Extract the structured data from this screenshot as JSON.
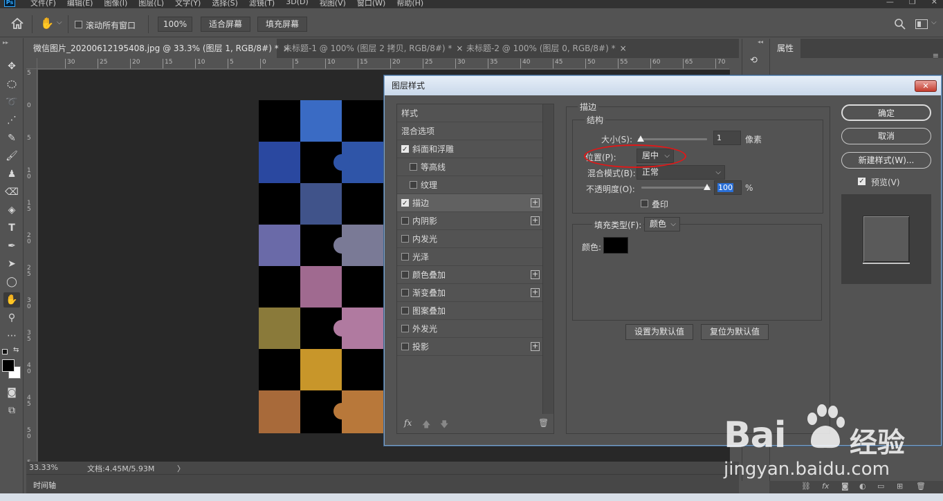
{
  "menubar": {
    "logo": "Ps",
    "items": [
      "文件(F)",
      "编辑(E)",
      "图像(I)",
      "图层(L)",
      "文字(Y)",
      "选择(S)",
      "滤镜(T)",
      "3D(D)",
      "视图(V)",
      "窗口(W)",
      "帮助(H)"
    ],
    "window_controls": [
      "—",
      "❐",
      "✕"
    ]
  },
  "options": {
    "scroll_all_label": "滚动所有窗口",
    "zoom_value": "100%",
    "fit_screen": "适合屏幕",
    "fill_screen": "填充屏幕"
  },
  "tabs": [
    {
      "label": "微信图片_20200612195408.jpg @ 33.3% (图层 1, RGB/8#) *",
      "close": "×"
    },
    {
      "label": "未标题-1 @ 100% (图层 2 拷贝, RGB/8#) *",
      "close": "×"
    },
    {
      "label": "未标题-2 @ 100% (图层 0, RGB/8#) *",
      "close": "×"
    }
  ],
  "ruler": {
    "h_labels": [
      "30",
      "25",
      "20",
      "15",
      "10",
      "5",
      "0",
      "5",
      "10",
      "15",
      "20",
      "25",
      "30",
      "35",
      "40",
      "45",
      "50",
      "55",
      "60",
      "65",
      "70"
    ],
    "v_labels": [
      "5",
      "0",
      "5",
      "1 0",
      "1 5",
      "2 0",
      "2 5",
      "3 0",
      "3 5",
      "4 0",
      "4 5",
      "5 0",
      "5 5"
    ]
  },
  "status": {
    "zoom": "33.33%",
    "doc": "文档:4.45M/5.93M",
    "arrow": "〉",
    "timeline": "时间轴"
  },
  "props": {
    "title": "属性"
  },
  "dialog": {
    "title": "图层样式",
    "close": "✕",
    "styles": [
      {
        "label": "样式",
        "checkbox": false,
        "checked": false,
        "plus": false,
        "indent": 0,
        "selected": false
      },
      {
        "label": "混合选项",
        "checkbox": false,
        "checked": false,
        "plus": false,
        "indent": 0,
        "selected": false
      },
      {
        "label": "斜面和浮雕",
        "checkbox": true,
        "checked": true,
        "plus": false,
        "indent": 0,
        "selected": false
      },
      {
        "label": "等高线",
        "checkbox": true,
        "checked": false,
        "plus": false,
        "indent": 1,
        "selected": false
      },
      {
        "label": "纹理",
        "checkbox": true,
        "checked": false,
        "plus": false,
        "indent": 1,
        "selected": false
      },
      {
        "label": "描边",
        "checkbox": true,
        "checked": true,
        "plus": true,
        "indent": 0,
        "selected": true
      },
      {
        "label": "内阴影",
        "checkbox": true,
        "checked": false,
        "plus": true,
        "indent": 0,
        "selected": false
      },
      {
        "label": "内发光",
        "checkbox": true,
        "checked": false,
        "plus": false,
        "indent": 0,
        "selected": false
      },
      {
        "label": "光泽",
        "checkbox": true,
        "checked": false,
        "plus": false,
        "indent": 0,
        "selected": false
      },
      {
        "label": "颜色叠加",
        "checkbox": true,
        "checked": false,
        "plus": true,
        "indent": 0,
        "selected": false
      },
      {
        "label": "渐变叠加",
        "checkbox": true,
        "checked": false,
        "plus": true,
        "indent": 0,
        "selected": false
      },
      {
        "label": "图案叠加",
        "checkbox": true,
        "checked": false,
        "plus": false,
        "indent": 0,
        "selected": false
      },
      {
        "label": "外发光",
        "checkbox": true,
        "checked": false,
        "plus": false,
        "indent": 0,
        "selected": false
      },
      {
        "label": "投影",
        "checkbox": true,
        "checked": false,
        "plus": true,
        "indent": 0,
        "selected": false
      }
    ],
    "footer_fx": "fx",
    "stroke": {
      "group_title": "描边",
      "structure_title": "结构",
      "size_label": "大小(S):",
      "size_value": "1",
      "size_unit": "像素",
      "position_label": "位置(P):",
      "position_value": "居中",
      "blend_label": "混合模式(B):",
      "blend_value": "正常",
      "opacity_label": "不透明度(O):",
      "opacity_value": "100",
      "opacity_unit": "%",
      "overprint_label": "叠印",
      "fill_type_label": "填充类型(F):",
      "fill_type_value": "颜色",
      "color_label": "颜色:",
      "color_value": "#000000",
      "set_default": "设置为默认值",
      "reset_default": "复位为默认值"
    },
    "buttons": {
      "ok": "确定",
      "cancel": "取消",
      "new_style": "新建样式(W)...",
      "preview_label": "预览(V)"
    }
  },
  "watermark": {
    "brand_en": "Bai",
    "brand_cn": "经验",
    "url": "jingyan.baidu.com"
  },
  "colors": {
    "accent_annotation": "#e01818",
    "title_bar": "#c9d8ea"
  }
}
